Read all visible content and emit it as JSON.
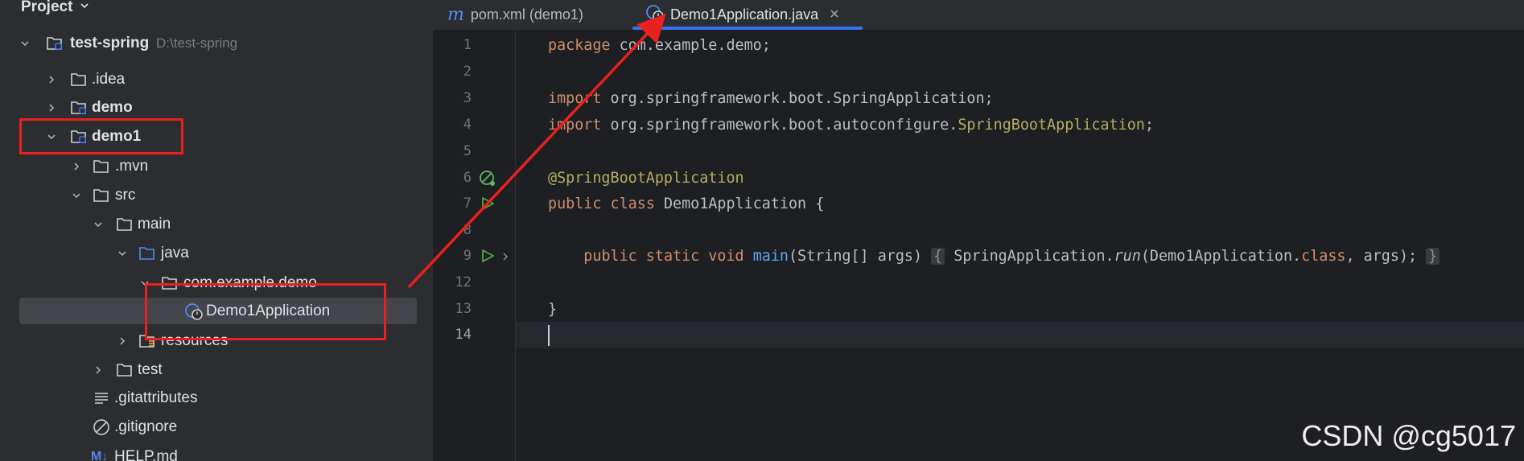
{
  "project_panel": {
    "title": "Project",
    "tree": [
      {
        "label": "test-spring",
        "hint": "D:\\test-spring",
        "kind": "module",
        "bold": true
      },
      {
        "label": ".idea",
        "kind": "folder"
      },
      {
        "label": "demo",
        "kind": "module",
        "bold": true
      },
      {
        "label": "demo1",
        "kind": "module",
        "bold": true
      },
      {
        "label": ".mvn",
        "kind": "folder"
      },
      {
        "label": "src",
        "kind": "folder"
      },
      {
        "label": "main",
        "kind": "folder"
      },
      {
        "label": "java",
        "kind": "source-folder"
      },
      {
        "label": "com.example.demo",
        "kind": "package"
      },
      {
        "label": "Demo1Application",
        "kind": "spring-class"
      },
      {
        "label": "resources",
        "kind": "resources-folder"
      },
      {
        "label": "test",
        "kind": "folder"
      },
      {
        "label": ".gitattributes",
        "kind": "text-file"
      },
      {
        "label": ".gitignore",
        "kind": "ignore-file"
      },
      {
        "label": "HELP.md",
        "kind": "markdown-file"
      }
    ]
  },
  "tabs": [
    {
      "label": "pom.xml (demo1)",
      "icon": "maven-icon",
      "active": false
    },
    {
      "label": "Demo1Application.java",
      "icon": "spring-class-icon",
      "active": true
    }
  ],
  "editor": {
    "line_numbers": [
      "1",
      "2",
      "3",
      "4",
      "5",
      "6",
      "7",
      "8",
      "9",
      "12",
      "13",
      "14"
    ],
    "lines": {
      "l1": {
        "kw": "package",
        "rest": " com.example.demo;"
      },
      "l3": {
        "kw": "import",
        "rest": " org.springframework.boot.SpringApplication;"
      },
      "l4": {
        "kw": "import",
        "rest": " org.springframework.boot.autoconfigure.",
        "ann": "SpringBootApplication",
        "end": ";"
      },
      "l6": {
        "ann": "@SpringBootApplication"
      },
      "l7": {
        "kw1": "public",
        "kw2": "class",
        "rest": " Demo1Application {"
      },
      "l9": {
        "kw": "public static void",
        "fn": "main",
        "params": "(String[] args)",
        "open": "{",
        "call": " SpringApplication.",
        "run": "run",
        "args": "(Demo1Application.",
        "cls": "class",
        "tail": ", args);",
        "close": "}"
      },
      "l13": {
        "text": "}"
      }
    }
  },
  "colors": {
    "keyword": "#cf8e6d",
    "annotation": "#b3ae60",
    "function": "#56a8f5",
    "highlight_box": "#e8201e",
    "tab_accent": "#3574f0"
  },
  "watermark": "CSDN @cg5017"
}
